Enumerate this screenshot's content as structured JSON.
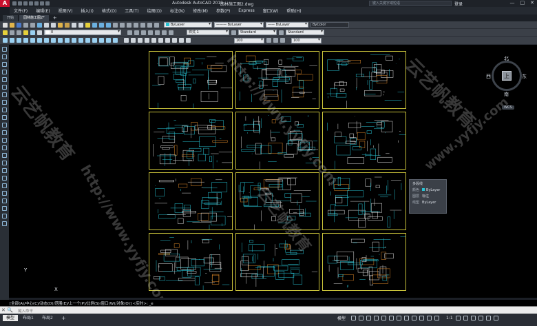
{
  "titlebar": {
    "app_title": "Autodesk AutoCAD 2019",
    "file_name": "园林施工图2.dwg",
    "search_placeholder": "键入关键字或短语",
    "login": "登录",
    "minimize": "—",
    "maximize": "□",
    "close": "✕"
  },
  "menu": {
    "items": [
      "文件(F)",
      "编辑(E)",
      "视图(V)",
      "插入(I)",
      "格式(O)",
      "工具(T)",
      "绘图(D)",
      "标注(N)",
      "修改(M)",
      "参数(P)",
      "Express",
      "窗口(W)",
      "帮助(H)"
    ]
  },
  "tabs": [
    {
      "label": "开始"
    },
    {
      "label": "园林施工图2*"
    }
  ],
  "tab_add": "+",
  "toolbar1": {
    "color": "ByLayer",
    "linetype": "ByLayer",
    "lineweight": "ByLayer",
    "plotstyle": "ByColor"
  },
  "toolbar2": {
    "layer": "0",
    "text_style": "样式 1",
    "dim_style": "Standard",
    "table_style": "Standard"
  },
  "toolbar3": {
    "scale": "100",
    "scale2": "100"
  },
  "viewcube": {
    "north": "北",
    "south": "南",
    "east": "东",
    "west": "西",
    "top": "上",
    "wcs": "WCS"
  },
  "tooltip": {
    "title": "多段线",
    "rows": [
      {
        "key": "颜色",
        "value": "ByLayer",
        "swatch": true
      },
      {
        "key": "图层",
        "value": "标注",
        "swatch": false
      },
      {
        "key": "线型",
        "value": "ByLayer",
        "swatch": false
      }
    ]
  },
  "watermarks": [
    "云艺帆教育",
    "http://www.yyfjy.com",
    "云艺帆教育",
    "http://www.yyfjy.com",
    "云艺帆教育",
    "www.yyfjy.com"
  ],
  "ucs": {
    "x": "X",
    "y": "Y"
  },
  "command": {
    "history": "[全部(A)/中心(C)/动态(D)/范围(E)/上一个(P)/比例(S)/窗口(W)/对象(O)] <实时>: _e",
    "placeholder": "键入命令"
  },
  "status": {
    "tabs": [
      "模型",
      "布局1",
      "布局2"
    ],
    "model": "模型",
    "scale": "1:1"
  },
  "colors": {
    "drawing_cyan": "#27c3d4",
    "frame_yellow": "#c9c23a",
    "accent_orange": "#e08a2a",
    "canvas_bg": "#000000"
  }
}
